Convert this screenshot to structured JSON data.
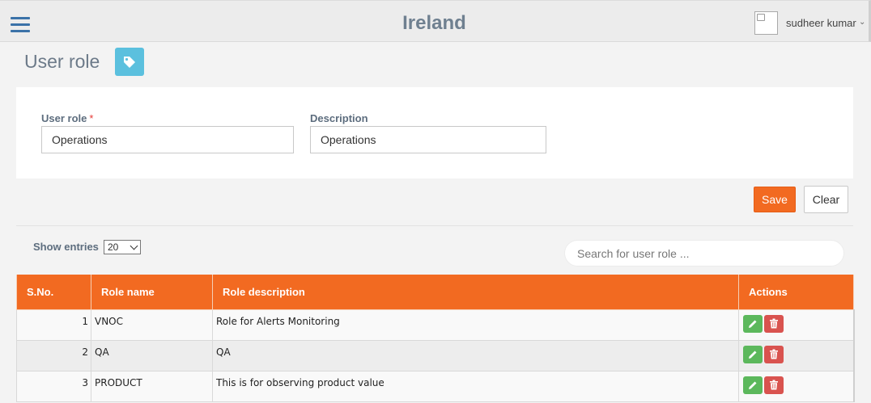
{
  "header": {
    "app_title": "Ireland",
    "user_name": "sudheer kumar"
  },
  "page": {
    "title": "User role"
  },
  "form": {
    "user_role_label": "User role",
    "required_mark": "*",
    "user_role_value": "Operations",
    "description_label": "Description",
    "description_value": "Operations"
  },
  "buttons": {
    "save": "Save",
    "clear": "Clear"
  },
  "table_controls": {
    "show_entries_label": "Show entries",
    "entries_value": "20",
    "search_placeholder": "Search for user role ..."
  },
  "table": {
    "columns": [
      "S.No.",
      "Role name",
      "Role description",
      "Actions"
    ],
    "rows": [
      {
        "sno": "1",
        "name": "VNOC",
        "description": "Role for Alerts Monitoring"
      },
      {
        "sno": "2",
        "name": "QA",
        "description": "QA"
      },
      {
        "sno": "3",
        "name": "PRODUCT",
        "description": "This is for observing product value"
      }
    ]
  },
  "colors": {
    "accent": "#f26a21",
    "edit": "#5cb85c",
    "delete": "#d9534f",
    "badge": "#5bc0de",
    "menu_icon": "#3b72a8"
  }
}
